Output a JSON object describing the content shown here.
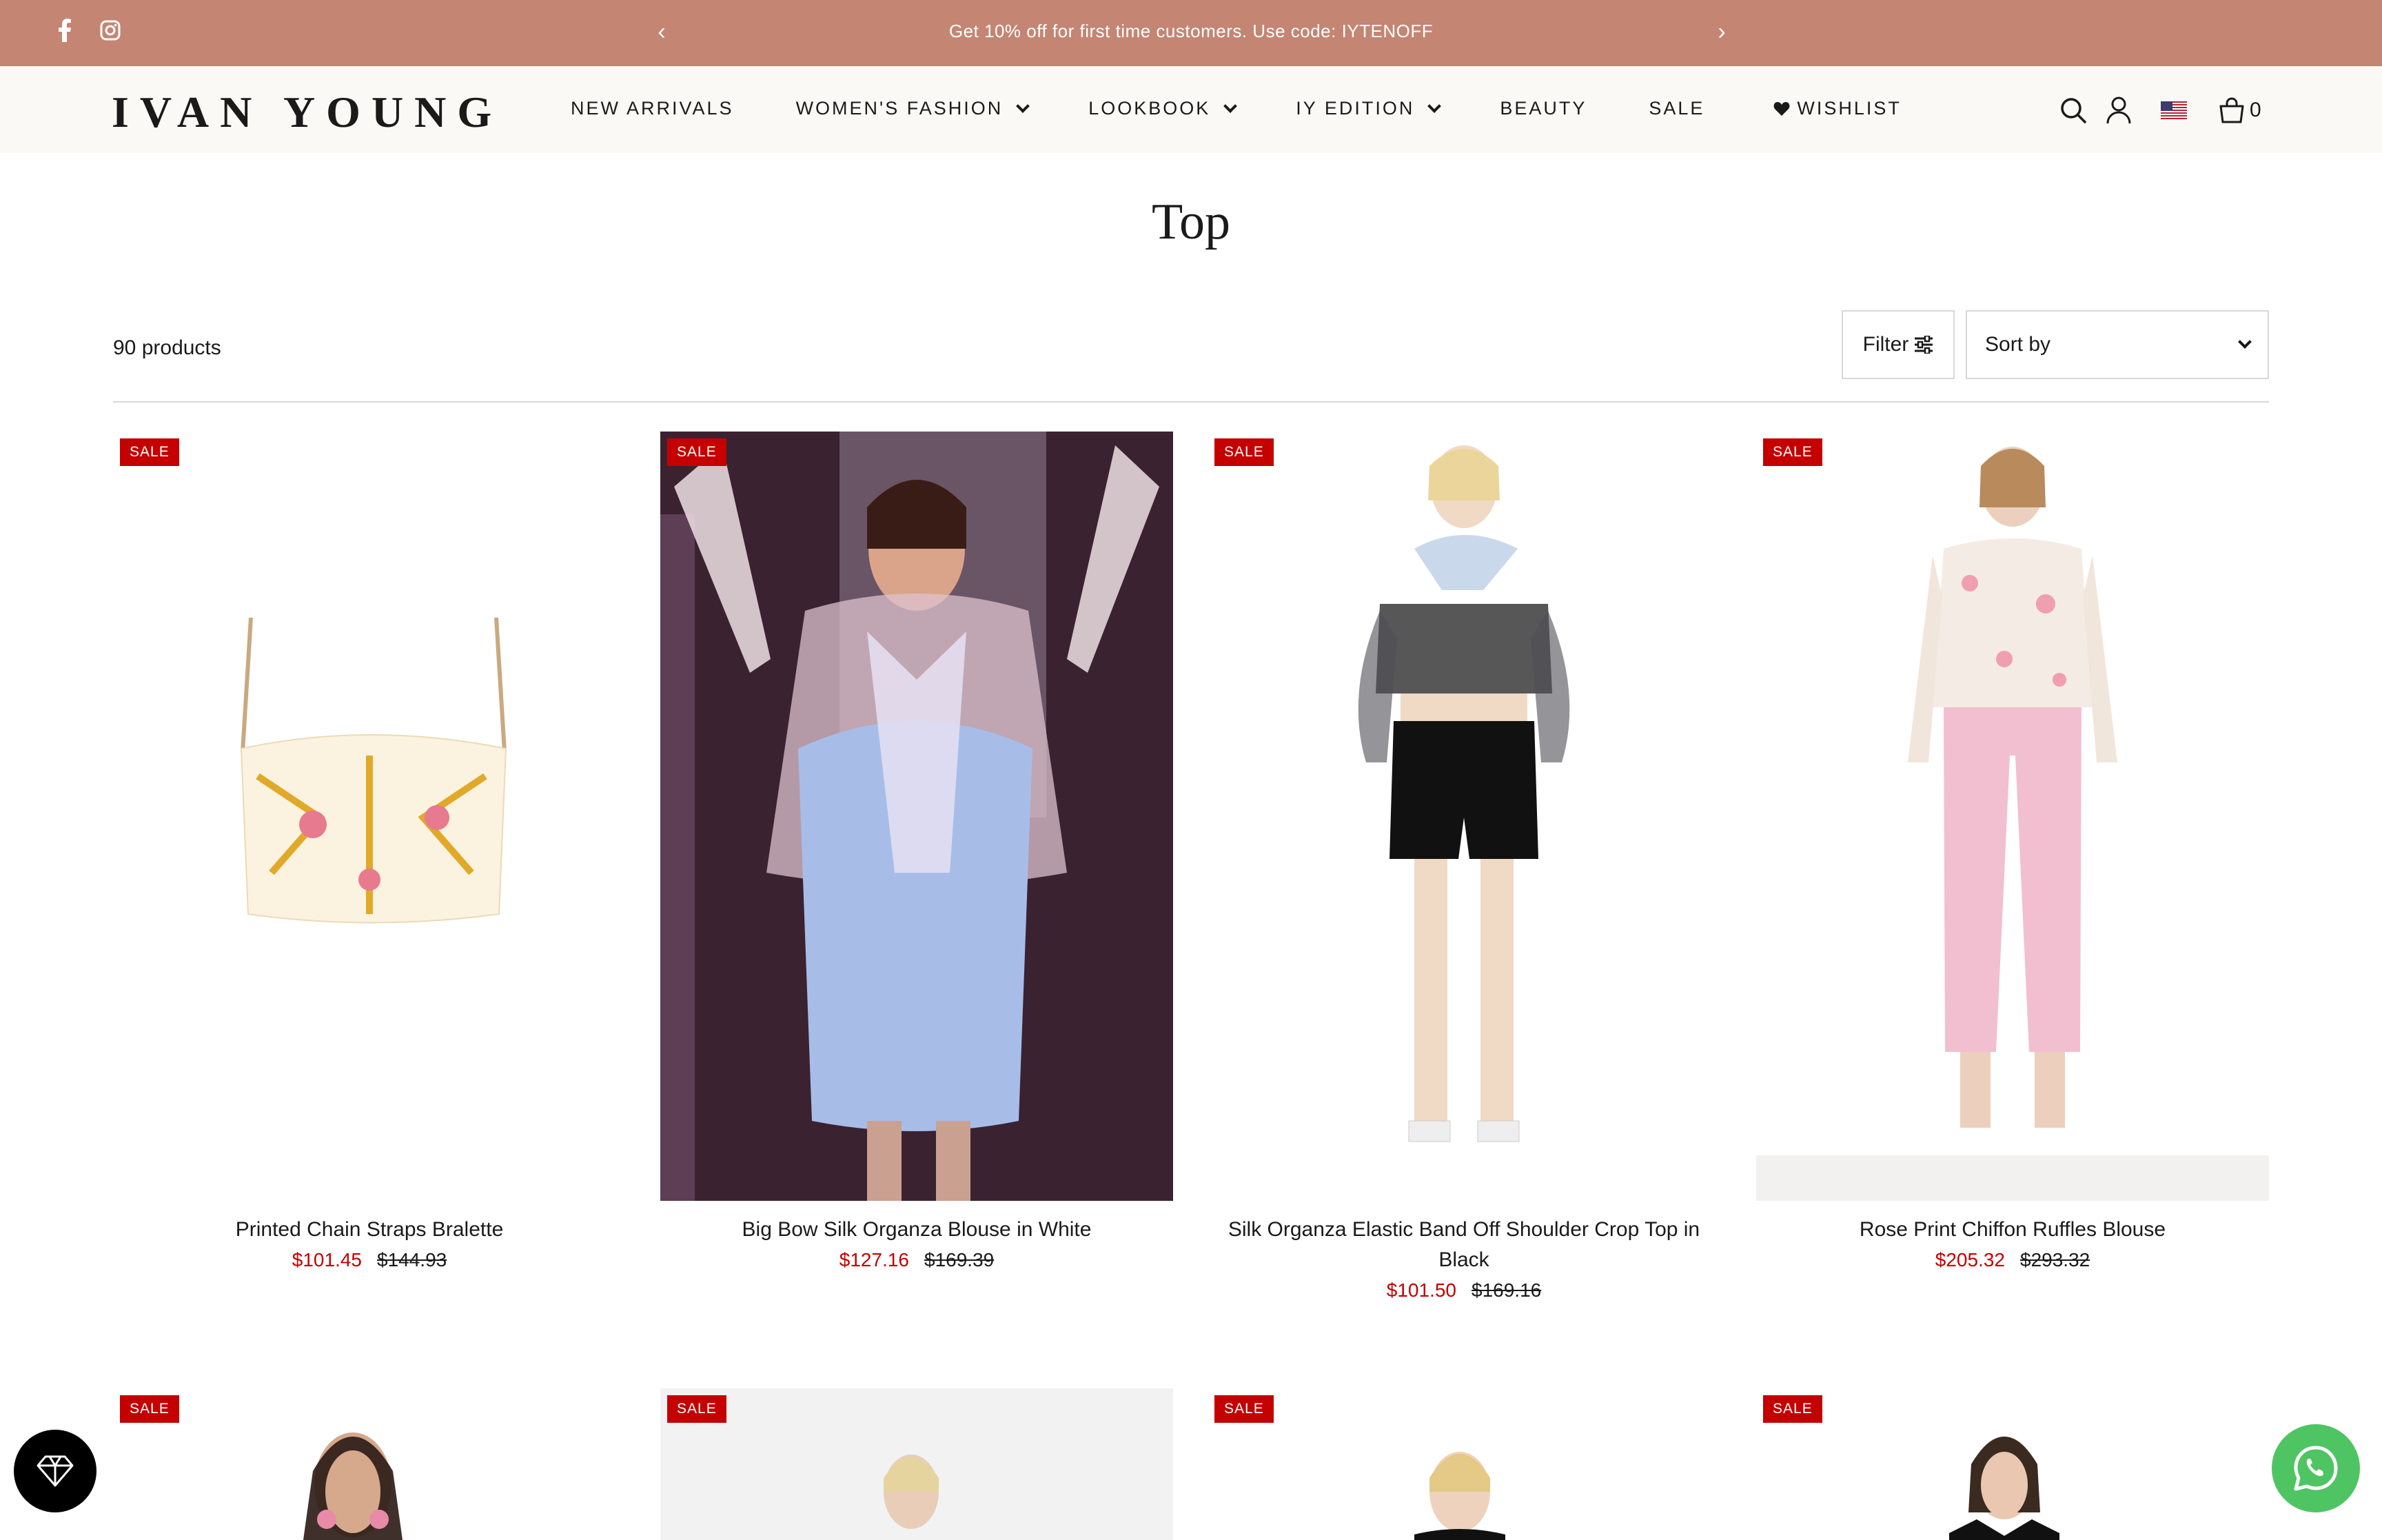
{
  "announcement": {
    "message": "Get 10% off for first time customers. Use code: IYTENOFF",
    "prev_icon": "chevron-left-icon",
    "next_icon": "chevron-right-icon",
    "social": [
      "facebook-icon",
      "instagram-icon"
    ],
    "background": "#c48573"
  },
  "header": {
    "logo": "IVAN YOUNG",
    "nav": [
      {
        "label": "NEW ARRIVALS",
        "dropdown": false
      },
      {
        "label": "WOMEN'S FASHION",
        "dropdown": true
      },
      {
        "label": "LOOKBOOK",
        "dropdown": true
      },
      {
        "label": "IY EDITION",
        "dropdown": true
      },
      {
        "label": "BEAUTY",
        "dropdown": false
      },
      {
        "label": "SALE",
        "dropdown": false
      },
      {
        "label": "WISHLIST",
        "dropdown": false,
        "icon": "heart-icon"
      }
    ],
    "icons": [
      "search-icon",
      "account-icon",
      "us-flag-icon",
      "cart-icon"
    ],
    "cart_count": "0",
    "background": "#fbf9f5"
  },
  "page": {
    "title": "Top",
    "product_count": "90 products",
    "filter_label": "Filter",
    "sort_label": "Sort by"
  },
  "products": [
    {
      "badge": "SALE",
      "name": "Printed Chain Straps Bralette",
      "price": "$101.45",
      "compare_price": "$144.93"
    },
    {
      "badge": "SALE",
      "name": "Big Bow Silk Organza Blouse in White",
      "price": "$127.16",
      "compare_price": "$169.39"
    },
    {
      "badge": "SALE",
      "name": "Silk Organza Elastic Band Off Shoulder Crop Top in Black",
      "price": "$101.50",
      "compare_price": "$169.16"
    },
    {
      "badge": "SALE",
      "name": "Rose Print Chiffon Ruffles Blouse",
      "price": "$205.32",
      "compare_price": "$293.32"
    },
    {
      "badge": "SALE"
    },
    {
      "badge": "SALE"
    },
    {
      "badge": "SALE"
    },
    {
      "badge": "SALE"
    }
  ],
  "colors": {
    "sale_red": "#c40000",
    "whatsapp_green": "#4fc462"
  },
  "widgets": [
    "diamond-icon",
    "whatsapp-icon"
  ]
}
